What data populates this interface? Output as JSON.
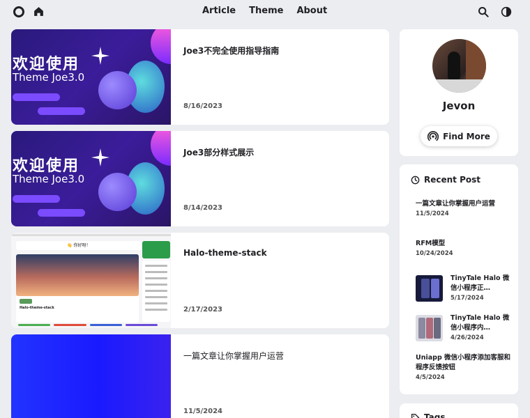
{
  "nav": {
    "items": [
      "Article",
      "Theme",
      "About"
    ]
  },
  "posts": [
    {
      "title": "Joe3不完全使用指导指南",
      "date": "8/16/2023",
      "thumb": {
        "cn": "欢迎使用",
        "en": "Theme Joe3.0"
      }
    },
    {
      "title": "Joe3部分样式展示",
      "date": "8/14/2023",
      "thumb": {
        "cn": "欢迎使用",
        "en": "Theme Joe3.0"
      }
    },
    {
      "title": "Halo-theme-stack",
      "date": "2/17/2023",
      "thumb": {
        "top_banner": "👋 你好呀！",
        "card_title": "Halo-theme-stack"
      }
    },
    {
      "title": "一篇文章让你掌握用户运营",
      "date": "11/5/2024"
    }
  ],
  "profile": {
    "name": "Jevon",
    "button_label": "Find More"
  },
  "recent": {
    "heading": "Recent Post",
    "items": [
      {
        "title": "一篇文章让你掌握用户运营",
        "date": "11/5/2024",
        "has_thumb": false
      },
      {
        "title": "RFM模型",
        "date": "10/24/2024",
        "has_thumb": false
      },
      {
        "title": "TinyTale Halo 微信小程序正…",
        "date": "5/17/2024",
        "has_thumb": true
      },
      {
        "title": "TinyTale Halo 微信小程序内…",
        "date": "4/26/2024",
        "has_thumb": true
      },
      {
        "title": "Uniapp 微信小程序添加客服和程序反馈按钮",
        "date": "4/5/2024",
        "has_thumb": false
      }
    ]
  },
  "tags": {
    "heading": "Tags"
  },
  "colors": {
    "background": "#ecedf1",
    "card": "#ffffff",
    "text": "#1f1f24"
  },
  "icons": [
    "logo-icon",
    "home-icon",
    "search-icon",
    "theme-toggle-icon",
    "podcast-icon",
    "clock-icon",
    "tag-icon"
  ]
}
